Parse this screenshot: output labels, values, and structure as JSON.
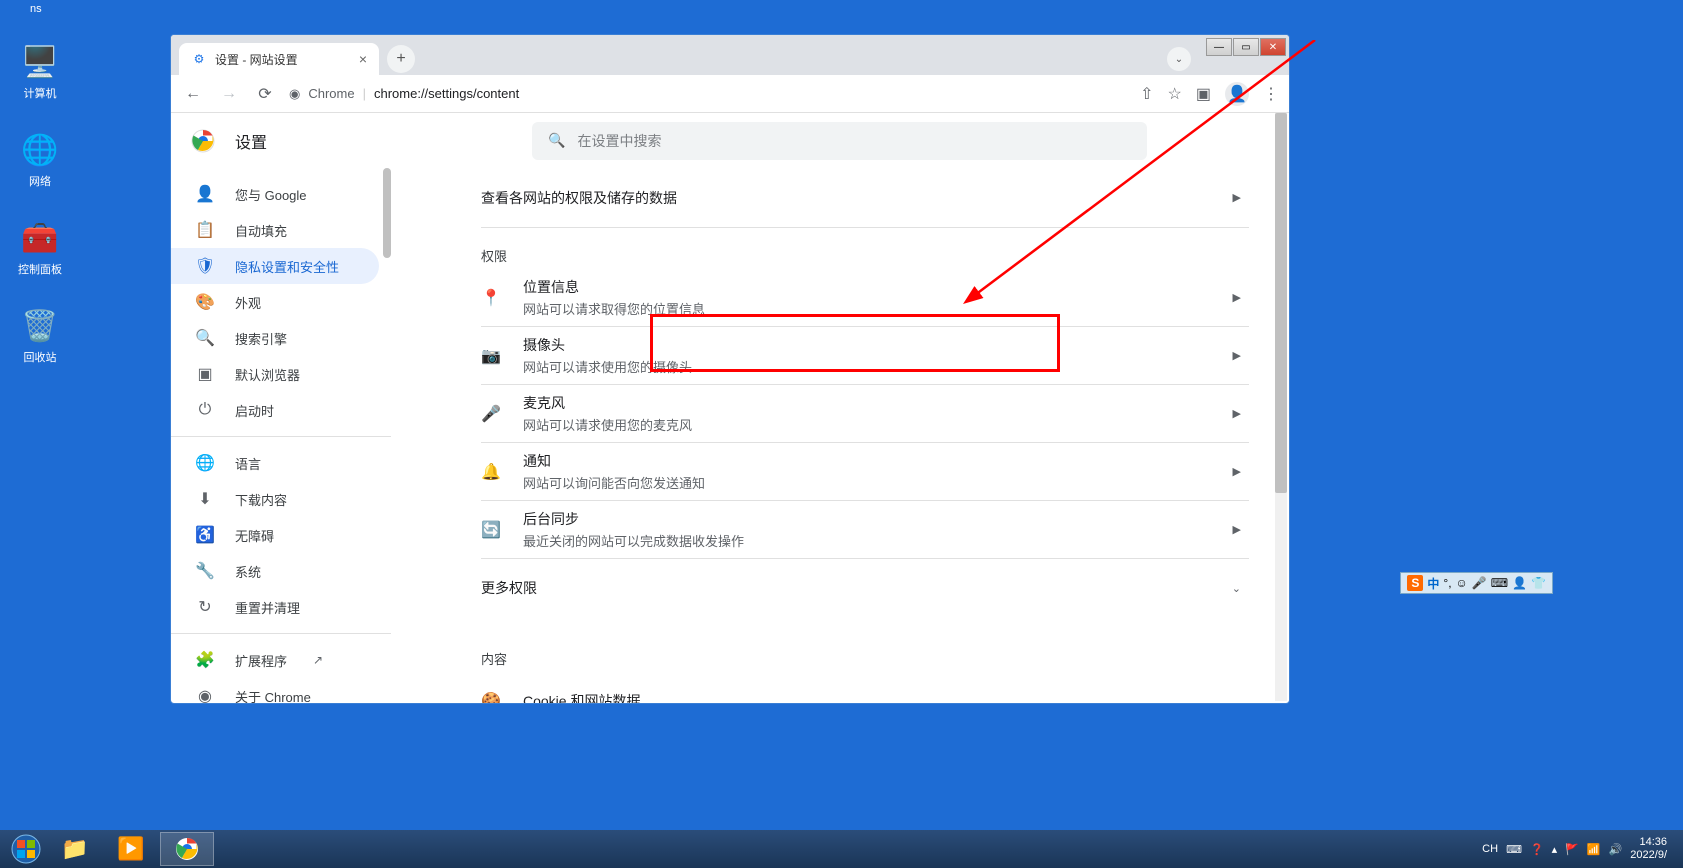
{
  "desktop": {
    "ns": "ns",
    "icons": [
      {
        "label": "计算机",
        "glyph": "🖥️"
      },
      {
        "label": "网络",
        "glyph": "🌐"
      },
      {
        "label": "控制面板",
        "glyph": "⚙️"
      },
      {
        "label": "回收站",
        "glyph": "🗑️"
      }
    ]
  },
  "window": {
    "tab_title": "设置 - 网站设置",
    "url_prefix": "Chrome",
    "url_path": "chrome://settings/content",
    "settings_label": "设置",
    "search_placeholder": "在设置中搜索"
  },
  "sidebar": [
    {
      "icon": "person",
      "label": "您与 Google"
    },
    {
      "icon": "autofill",
      "label": "自动填充"
    },
    {
      "icon": "shield",
      "label": "隐私设置和安全性",
      "active": true
    },
    {
      "icon": "brush",
      "label": "外观"
    },
    {
      "icon": "search",
      "label": "搜索引擎"
    },
    {
      "icon": "browser",
      "label": "默认浏览器"
    },
    {
      "icon": "power",
      "label": "启动时"
    }
  ],
  "sidebar2": [
    {
      "icon": "globe",
      "label": "语言"
    },
    {
      "icon": "download",
      "label": "下载内容"
    },
    {
      "icon": "accessibility",
      "label": "无障碍"
    },
    {
      "icon": "wrench",
      "label": "系统"
    },
    {
      "icon": "restore",
      "label": "重置并清理"
    }
  ],
  "sidebar3": [
    {
      "icon": "puzzle",
      "label": "扩展程序",
      "ext": true
    },
    {
      "icon": "chrome",
      "label": "关于 Chrome"
    }
  ],
  "content": {
    "top_row": "查看各网站的权限及储存的数据",
    "perm_label": "权限",
    "permissions": [
      {
        "icon": "📍",
        "title": "位置信息",
        "desc": "网站可以请求取得您的位置信息",
        "highlight": true
      },
      {
        "icon": "📷",
        "title": "摄像头",
        "desc": "网站可以请求使用您的摄像头"
      },
      {
        "icon": "🎤",
        "title": "麦克风",
        "desc": "网站可以请求使用您的麦克风"
      },
      {
        "icon": "🔔",
        "title": "通知",
        "desc": "网站可以询问能否向您发送通知"
      },
      {
        "icon": "🔄",
        "title": "后台同步",
        "desc": "最近关闭的网站可以完成数据收发操作"
      }
    ],
    "more_perms": "更多权限",
    "content_label": "内容",
    "cookie_row": "Cookie 和网站数据"
  },
  "ime": {
    "chars": [
      "中",
      "°,",
      "☺",
      "🎤",
      "⌨",
      "👤",
      "👕"
    ]
  },
  "taskbar": {
    "lang": "CH",
    "time": "14:36",
    "date": "2022/9/"
  }
}
